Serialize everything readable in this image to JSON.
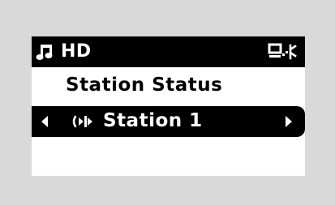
{
  "device": {
    "background_color": "#d9d9d9",
    "screen_color": "#ffffff",
    "highlight_color": "#000000"
  },
  "status_bar": {
    "mode_label": "HD",
    "music_icon": "music-note-icon",
    "signal_icon": "antenna-signal-icon"
  },
  "menu": {
    "title": "Station Status",
    "selected_item": {
      "label": "Station 1",
      "left_icon": "left-arrow-icon",
      "station_icon": "station-audio-icon",
      "right_icon": "right-arrow-icon"
    }
  }
}
